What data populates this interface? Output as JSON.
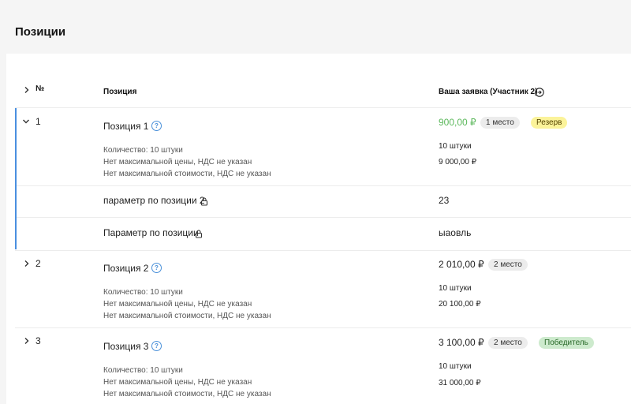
{
  "page": {
    "title": "Позиции"
  },
  "header": {
    "num": "№",
    "position": "Позиция",
    "bid": "Ваша заявка (Участник 2)"
  },
  "rows": [
    {
      "num": "1",
      "name": "Позиция 1",
      "qty_label": "Количество: 10 штуки",
      "max_price": "Нет максимальной цены, НДС не указан",
      "max_cost": "Нет максимальной стоимости, НДС не указан",
      "price": "900,00 ₽",
      "rank": "1 место",
      "status": "Резерв",
      "qty": "10 штуки",
      "total": "9 000,00 ₽",
      "params": [
        {
          "name": "параметр по позиции 2",
          "value": "23"
        },
        {
          "name": "Параметр по позиции",
          "value": "ыаовль"
        }
      ]
    },
    {
      "num": "2",
      "name": "Позиция 2",
      "qty_label": "Количество: 10 штуки",
      "max_price": "Нет максимальной цены, НДС не указан",
      "max_cost": "Нет максимальной стоимости, НДС не указан",
      "price": "2 010,00 ₽",
      "rank": "2 место",
      "qty": "10 штуки",
      "total": "20 100,00 ₽"
    },
    {
      "num": "3",
      "name": "Позиция 3",
      "qty_label": "Количество: 10 штуки",
      "max_price": "Нет максимальной цены, НДС не указан",
      "max_cost": "Нет максимальной стоимости, НДС не указан",
      "price": "3 100,00 ₽",
      "rank": "2 место",
      "status": "Победитель",
      "qty": "10 штуки",
      "total": "31 000,00 ₽"
    }
  ],
  "colors": {
    "accent_bar": "#4a8fe0",
    "price_green": "#5cb85c",
    "badge_yellow": "#fbf39a",
    "badge_green": "#cdeacd"
  },
  "icons": {
    "expand": "chevron-right-icon",
    "collapse": "chevron-down-icon",
    "help": "question-circle-icon",
    "lock": "lock-icon",
    "go": "arrow-circle-right-icon"
  }
}
